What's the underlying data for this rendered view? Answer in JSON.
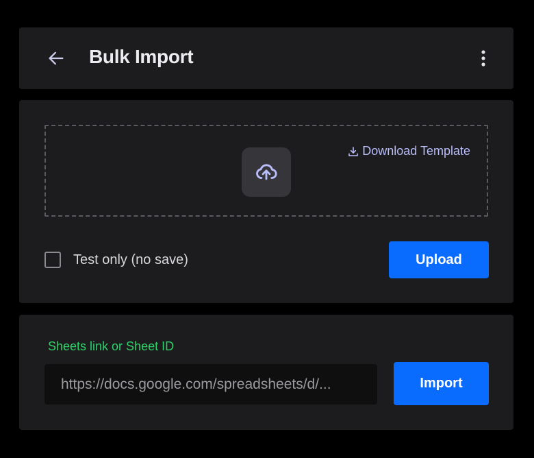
{
  "header": {
    "title": "Bulk Import",
    "back_icon": "arrow-left-icon",
    "menu_icon": "more-vertical-icon"
  },
  "upload": {
    "dropzone_icon": "cloud-upload-icon",
    "download_template_label": "Download Template",
    "download_icon": "download-icon",
    "test_only_label": "Test only (no save)",
    "test_only_checked": false,
    "upload_label": "Upload"
  },
  "import": {
    "field_label": "Sheets link or Sheet ID",
    "input_placeholder": "https://docs.google.com/spreadsheets/d/...",
    "import_label": "Import"
  },
  "colors": {
    "background": "#000000",
    "card": "#1c1c1e",
    "accent": "#0a6bff",
    "link": "#b9bdfa",
    "field_label": "#2fd069"
  }
}
